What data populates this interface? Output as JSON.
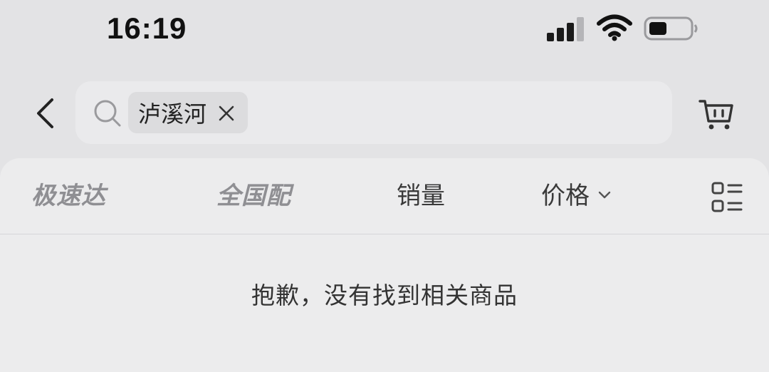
{
  "status_bar": {
    "time": "16:19",
    "signal_icon": "cellular-signal-icon",
    "wifi_icon": "wifi-icon",
    "battery_icon": "battery-icon",
    "battery_level": 0.4
  },
  "header": {
    "back_icon": "chevron-left-icon",
    "search": {
      "icon": "search-icon",
      "chip_label": "泸溪河",
      "chip_close_icon": "close-icon"
    },
    "cart_icon": "shopping-cart-icon"
  },
  "filters": {
    "items": [
      {
        "label": "极速达"
      },
      {
        "label": "全国配"
      },
      {
        "label": "销量"
      },
      {
        "label": "价格"
      }
    ],
    "price_dropdown_icon": "chevron-down-icon",
    "layout_toggle_icon": "list-layout-icon"
  },
  "results": {
    "empty_message": "抱歉，没有找到相关商品"
  },
  "colors": {
    "background": "#e3e3e5",
    "panel": "#ececed",
    "search_box": "#eaeaec",
    "chip": "#dcdcde",
    "muted_text": "#8f8f93"
  }
}
